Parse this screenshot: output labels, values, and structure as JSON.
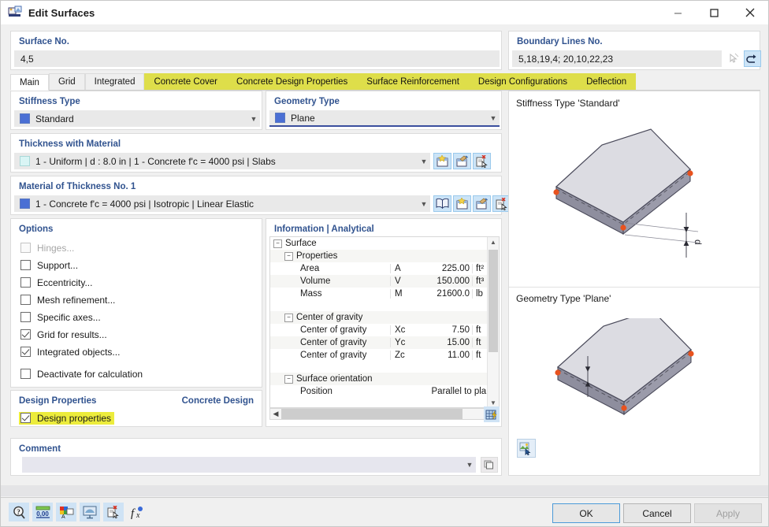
{
  "window": {
    "title": "Edit Surfaces",
    "icon": "edit-surfaces-icon",
    "minimize": "—",
    "maximize": "□",
    "close": "✕"
  },
  "surface_no": {
    "label": "Surface No.",
    "value": "4,5"
  },
  "boundary_lines": {
    "label": "Boundary Lines No.",
    "value": "5,18,19,4; 20,10,22,23",
    "pick_icon": "pick-cursor-icon",
    "reverse_icon": "reverse-arrow-icon"
  },
  "tabs": [
    {
      "label": "Main",
      "active": true,
      "highlight": false
    },
    {
      "label": "Grid",
      "active": false,
      "highlight": false
    },
    {
      "label": "Integrated",
      "active": false,
      "highlight": false
    },
    {
      "label": "Concrete Cover",
      "active": false,
      "highlight": true
    },
    {
      "label": "Concrete Design Properties",
      "active": false,
      "highlight": true
    },
    {
      "label": "Surface Reinforcement",
      "active": false,
      "highlight": true
    },
    {
      "label": "Design Configurations",
      "active": false,
      "highlight": true
    },
    {
      "label": "Deflection",
      "active": false,
      "highlight": true
    }
  ],
  "stiffness": {
    "label": "Stiffness Type",
    "value": "Standard",
    "swatch": "#4a6fd4"
  },
  "geometry": {
    "label": "Geometry Type",
    "value": "Plane",
    "swatch": "#4a6fd4"
  },
  "thickness": {
    "label": "Thickness with Material",
    "value": "1 - Uniform | d : 8.0 in | 1 - Concrete f'c = 4000 psi | Slabs",
    "swatch": "#d9f5f5",
    "buttons": [
      "new-thickness-icon",
      "edit-thickness-icon",
      "delete-thickness-icon"
    ]
  },
  "material": {
    "label": "Material of Thickness No. 1",
    "value": "1 - Concrete f'c = 4000 psi | Isotropic | Linear Elastic",
    "swatch": "#4a6fd4",
    "buttons": [
      "material-library-icon",
      "new-material-icon",
      "edit-material-icon",
      "delete-material-icon"
    ]
  },
  "options": {
    "title": "Options",
    "items": [
      {
        "label": "Hinges...",
        "checked": false,
        "disabled": true
      },
      {
        "label": "Support...",
        "checked": false,
        "disabled": false
      },
      {
        "label": "Eccentricity...",
        "checked": false,
        "disabled": false
      },
      {
        "label": "Mesh refinement...",
        "checked": false,
        "disabled": false
      },
      {
        "label": "Specific axes...",
        "checked": false,
        "disabled": false
      },
      {
        "label": "Grid for results...",
        "checked": true,
        "disabled": false
      },
      {
        "label": "Integrated objects...",
        "checked": true,
        "disabled": false
      },
      {
        "label": "Deactivate for calculation",
        "checked": false,
        "disabled": false
      }
    ]
  },
  "design_properties": {
    "title": "Design Properties",
    "right_title": "Concrete Design",
    "checkbox_label": "Design properties",
    "checked": true,
    "highlighted": true
  },
  "information": {
    "title": "Information | Analytical",
    "rows": [
      {
        "indent": 0,
        "expander": "−",
        "name": "Surface",
        "symbol": "",
        "value": "",
        "unit": ""
      },
      {
        "indent": 1,
        "expander": "−",
        "name": "Properties",
        "symbol": "",
        "value": "",
        "unit": ""
      },
      {
        "indent": 2,
        "expander": "",
        "name": "Area",
        "symbol": "A",
        "value": "225.00",
        "unit": "ft²"
      },
      {
        "indent": 2,
        "expander": "",
        "name": "Volume",
        "symbol": "V",
        "value": "150.000",
        "unit": "ft³"
      },
      {
        "indent": 2,
        "expander": "",
        "name": "Mass",
        "symbol": "M",
        "value": "21600.0",
        "unit": "lb"
      },
      {
        "indent": 0,
        "expander": "",
        "name": "",
        "symbol": "",
        "value": "",
        "unit": ""
      },
      {
        "indent": 1,
        "expander": "−",
        "name": "Center of gravity",
        "symbol": "",
        "value": "",
        "unit": ""
      },
      {
        "indent": 2,
        "expander": "",
        "name": "Center of gravity",
        "symbol": "Xc",
        "value": "7.50",
        "unit": "ft"
      },
      {
        "indent": 2,
        "expander": "",
        "name": "Center of gravity",
        "symbol": "Yc",
        "value": "15.00",
        "unit": "ft"
      },
      {
        "indent": 2,
        "expander": "",
        "name": "Center of gravity",
        "symbol": "Zc",
        "value": "11.00",
        "unit": "ft"
      },
      {
        "indent": 0,
        "expander": "",
        "name": "",
        "symbol": "",
        "value": "",
        "unit": ""
      },
      {
        "indent": 1,
        "expander": "−",
        "name": "Surface orientation",
        "symbol": "",
        "value": "",
        "unit": ""
      },
      {
        "indent": 2,
        "expander": "",
        "name": "Position",
        "symbol": "",
        "value": "Parallel to plane",
        "unit": ""
      }
    ],
    "scroll_up": "▲",
    "scroll_down": "▼",
    "scroll_left": "◀",
    "scroll_right": "▶",
    "grid_button_icon": "results-grid-icon"
  },
  "comment": {
    "label": "Comment",
    "value": "",
    "copy_icon": "copy-comment-icon"
  },
  "preview": {
    "top_caption": "Stiffness Type 'Standard'",
    "bottom_caption": "Geometry Type 'Plane'",
    "thickness_symbol": "d",
    "render_icon": "render-view-icon"
  },
  "command_bar": {
    "tools": [
      "help-info-icon",
      "number-format-icon",
      "display-properties-icon",
      "visibility-icon",
      "delete-object-icon",
      "formula-icon"
    ],
    "ok": "OK",
    "cancel": "Cancel",
    "apply": "Apply",
    "apply_enabled": false
  }
}
